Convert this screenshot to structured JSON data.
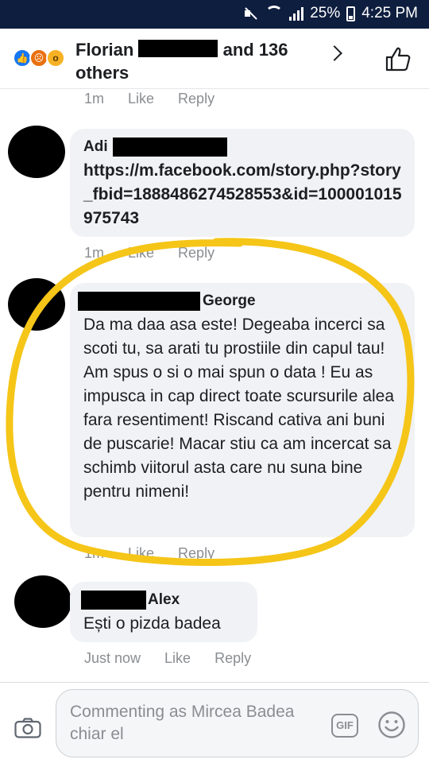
{
  "status_bar": {
    "battery": "25%",
    "time": "4:25 PM"
  },
  "header": {
    "title_first": "Florian",
    "title_rest": "and 136 others",
    "reactions": [
      "like-icon",
      "angry-icon",
      "wow-icon"
    ]
  },
  "comments": [
    {
      "id": "c0",
      "time": "1m",
      "like": "Like",
      "reply": "Reply"
    },
    {
      "id": "c1",
      "author": "Adi",
      "text": "https://m.facebook.com/story.php?story_fbid=1888486274528553&id=100001015975743",
      "time": "1m",
      "like": "Like",
      "reply": "Reply"
    },
    {
      "id": "c2",
      "author": "George",
      "text": "Da ma daa asa este! Degeaba incerci sa scoti tu, sa arati tu prostiile din capul tau! Am spus o si o mai spun o data ! Eu as impusca in cap direct toate scursurile alea fara resentiment! Riscand cativa ani buni de puscarie! Macar stiu ca am incercat sa schimb viitorul asta care nu suna bine pentru nimeni!",
      "time": "1m",
      "like": "Like",
      "reply": "Reply"
    },
    {
      "id": "c3",
      "author": "Alex",
      "text": "Ești o pizda badea",
      "time": "Just now",
      "like": "Like",
      "reply": "Reply"
    }
  ],
  "composer": {
    "placeholder": "Commenting as Mircea Badea chiar el",
    "gif_label": "GIF"
  },
  "colors": {
    "status_bar": "#0e1e3f",
    "like_blue": "#1877f2",
    "highlight": "#f5c518",
    "bubble": "#f0f2f5",
    "meta_text": "#8a8d91"
  }
}
